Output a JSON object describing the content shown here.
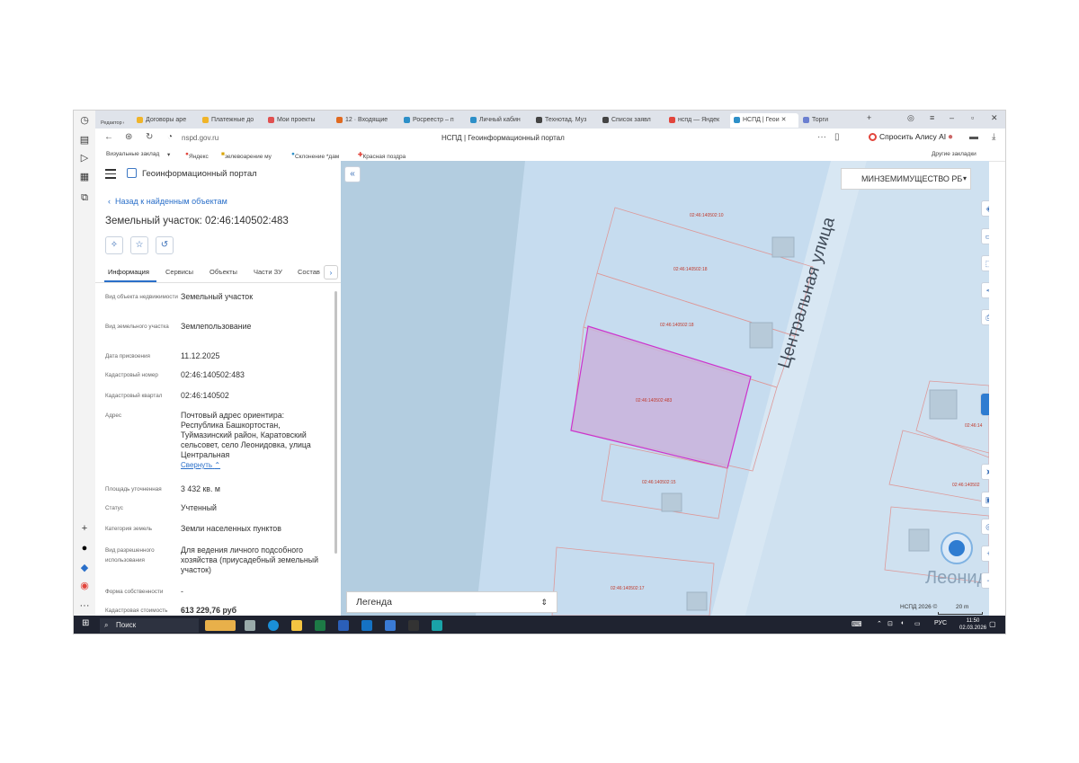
{
  "browser": {
    "tabs": [
      {
        "label": "Договоры аре",
        "color": "#f0b429"
      },
      {
        "label": "Платежные до",
        "color": "#f0b429"
      },
      {
        "label": "Мои проекты",
        "color": "#e05050"
      },
      {
        "label": "12 · Входящие",
        "color": "#e06a20"
      },
      {
        "label": "Росреестр – п",
        "color": "#2d8fc8"
      },
      {
        "label": "Личный кабин",
        "color": "#2d8fc8"
      },
      {
        "label": "Технотад. Муз",
        "color": "#444444"
      },
      {
        "label": "Список заявл",
        "color": "#444444"
      },
      {
        "label": "нспд — Яндек",
        "color": "#e2453c"
      },
      {
        "label": "НСПД | Геои",
        "color": "#2d8fc8"
      },
      {
        "label": "Торги",
        "color": "#6b7fd0"
      }
    ],
    "screenshot_editor_label": "Редактор скриншотов",
    "url": "nspd.gov.ru",
    "page_title": "НСПД | Геоинформационный портал",
    "alice_label": "Спросить Алису AI",
    "bookmarks": [
      "Визуальные заклад",
      "Яндекс",
      "зелевоарение му",
      "Склонение *дам",
      "Красная поздра"
    ],
    "other_bookmarks": "Другие закладки"
  },
  "panel": {
    "brand": "Геоинформационный портал",
    "back_label": "Назад к найденным объектам",
    "object_title": "Земельный участок: 02:46:140502:483",
    "tabs": [
      "Информация",
      "Сервисы",
      "Объекты",
      "Части ЗУ",
      "Состав"
    ],
    "rows": [
      {
        "k": "Вид объекта недвижимости",
        "v": "Земельный участок"
      },
      {
        "k": "Вид земельного участка",
        "v": "Землепользование"
      },
      {
        "k": "Дата присвоения",
        "v": "11.12.2025"
      },
      {
        "k": "Кадастровый номер",
        "v": "02:46:140502:483"
      },
      {
        "k": "Кадастровый квартал",
        "v": "02:46:140502"
      },
      {
        "k": "Адрес",
        "v": "Почтовый адрес ориентира: Республика Башкортостан, Туймазинский район, Каратовский сельсовет, село Леонидовка, улица Центральная"
      },
      {
        "k": "Площадь уточненная",
        "v": "3 432 кв. м"
      },
      {
        "k": "Статус",
        "v": "Учтенный"
      },
      {
        "k": "Категория земель",
        "v": "Земли населенных пунктов"
      },
      {
        "k": "Вид разрешенного использования",
        "v": "Для ведения личного подсобного хозяйства (приусадебный земельный участок)"
      },
      {
        "k": "Форма собственности",
        "v": "-"
      },
      {
        "k": "Кадастровая стоимость",
        "v": "613 229,76 руб"
      }
    ],
    "collapse_link": "Свернуть"
  },
  "map": {
    "layer_selector": "МИНЗЕМИМУЩЕСТВО РБ",
    "street_label": "Центральная улица",
    "village_label": "Леонид",
    "parcel_labels": [
      "02:46:140502:10",
      "02:46:140502:18",
      "02:46:140502:18",
      "02:46:140502:483",
      "02:46:140502:15",
      "02:46:140502:17",
      "02:46:14",
      "02:46:140502"
    ],
    "legend_label": "Легенда",
    "attribution": "НСПД 2026 ©",
    "scale_label": "20 m",
    "highlight_color": "#cc33cc"
  },
  "taskbar": {
    "search_label": "Поиск",
    "lang": "РУС",
    "time": "11:50",
    "date": "02.03.2026"
  }
}
